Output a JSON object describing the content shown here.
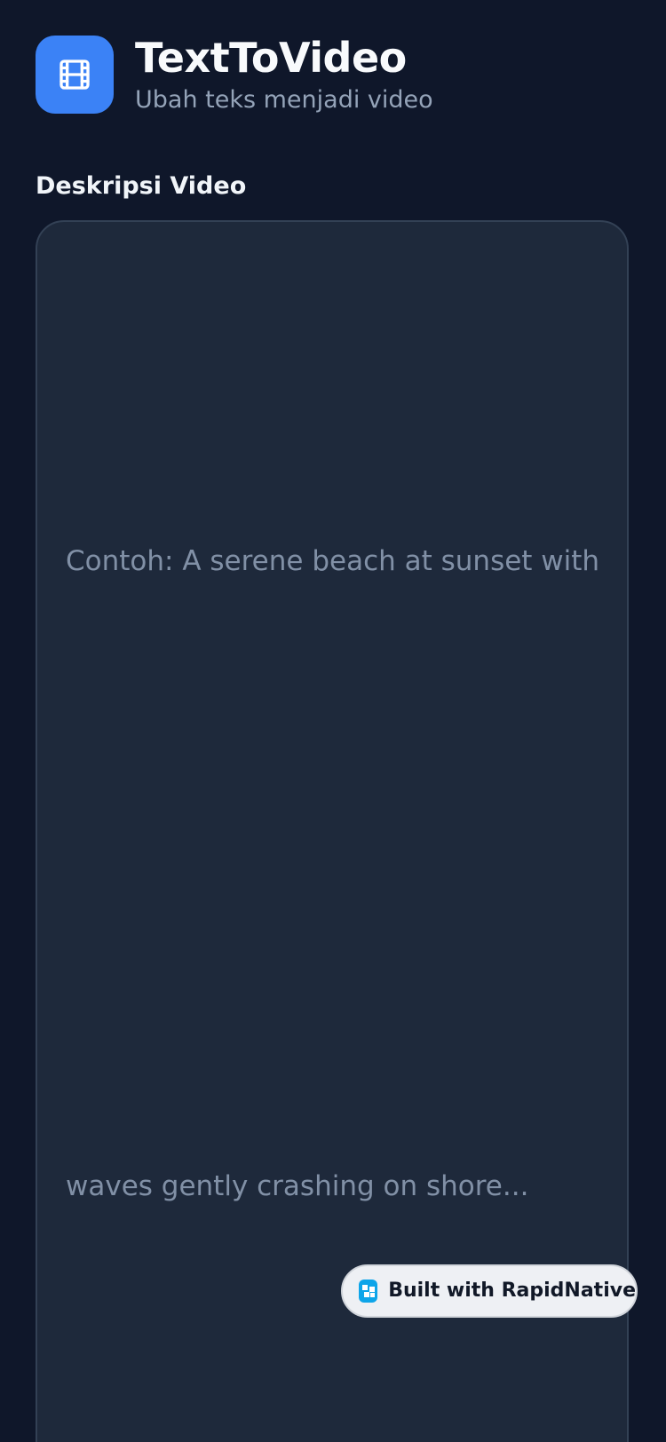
{
  "header": {
    "logo_icon": "film-icon",
    "title": "TextToVideo",
    "subtitle": "Ubah teks menjadi video"
  },
  "form": {
    "description_label": "Deskripsi Video",
    "description_placeholder_line1": "Contoh: A serene beach at sunset with",
    "description_placeholder_line2": "waves gently crashing on shore..."
  },
  "badge": {
    "icon": "rapidnative-icon",
    "label": "Built with RapidNative"
  },
  "colors": {
    "background": "#0f172a",
    "accent": "#3b82f6",
    "input_background": "#1e293b"
  }
}
